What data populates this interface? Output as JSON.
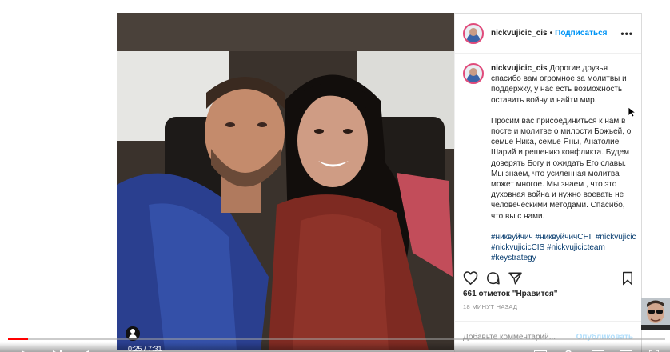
{
  "post": {
    "username": "nickvujicic_cis",
    "separator": "•",
    "follow_label": "Подписаться",
    "more_label": "•••",
    "caption_username": "nickvujicic_cis",
    "caption_p1": "Дорогие друзья спасибо вам огромное за молитвы и поддержку, у нас есть возможность оставить войну и найти мир.",
    "caption_p2": "Просим вас присоединиться к нам в посте и молитве о милости Божьей, о семье Ника, семье Яны, Анатолие Шарий и решению конфликта. Будем доверять Богу и ожидать Его славы. Мы знаем, что усиленная молитва может многое. Мы знаем , что это духовная война и нужно воевать не человеческими методами. Спасибо, что вы с нами.",
    "hashtags": "#никвуйчич #никвуйчичСНГ #nickvujicic #nickvujicicCIS #nickvujicicteam #keystrategy",
    "likes_text": "661 отметок \"Нравится\"",
    "time_text": "18 МИНУТ НАЗАД",
    "comment_placeholder": "Добавьте комментарий...",
    "publish_label": "Опубликовать"
  },
  "icons": [
    "heart-icon",
    "comment-icon",
    "share-icon",
    "bookmark-icon",
    "tagged-user-icon",
    "more-options-icon"
  ],
  "player": {
    "progress": 0.031,
    "time_readout": "0:25 / 7:31"
  },
  "colors": {
    "link_blue": "#0095f6",
    "hashtag_blue": "#00376b",
    "text": "#262626",
    "muted": "#8e8e8e",
    "progress_red": "#ff0000"
  }
}
